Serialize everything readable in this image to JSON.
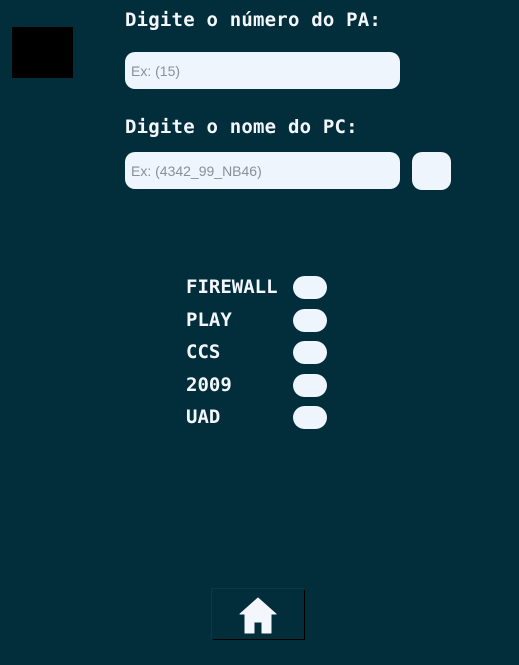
{
  "pa_section": {
    "label": "Digite o número do PA:",
    "placeholder": "Ex: (15)",
    "value": ""
  },
  "pc_section": {
    "label": "Digite o nome do PC:",
    "placeholder": "Ex: (4342_99_NB46)",
    "value": ""
  },
  "options": [
    {
      "label": "FIREWALL",
      "state": "off"
    },
    {
      "label": "PLAY",
      "state": "off"
    },
    {
      "label": "CCS",
      "state": "off"
    },
    {
      "label": "2009",
      "state": "off"
    },
    {
      "label": "UAD",
      "state": "off"
    }
  ],
  "icons": {
    "home": "home-icon"
  },
  "colors": {
    "background": "#022d3b",
    "text": "#f3f7fb",
    "field": "#eef5fd",
    "logo_block": "#000000"
  }
}
